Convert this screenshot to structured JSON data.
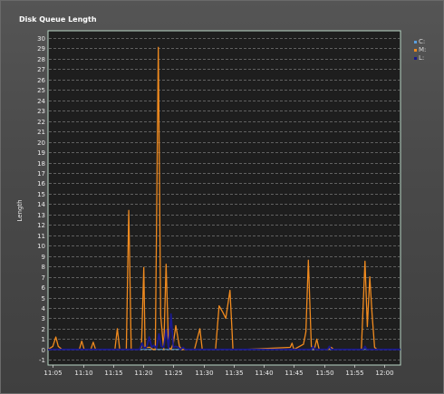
{
  "chart_data": {
    "type": "line",
    "title": "Disk Queue Length",
    "ylabel": "Length",
    "xlabel": "",
    "ylim": [
      -1.5,
      30.7
    ],
    "yticks": [
      -1,
      0,
      1,
      2,
      3,
      4,
      5,
      6,
      7,
      8,
      9,
      10,
      11,
      12,
      13,
      14,
      15,
      16,
      17,
      18,
      19,
      20,
      21,
      22,
      23,
      24,
      25,
      26,
      27,
      28,
      29,
      30
    ],
    "xlim": [
      64.2,
      122.7
    ],
    "xticks": [
      {
        "v": 65,
        "label": "11:05"
      },
      {
        "v": 70,
        "label": "11:10"
      },
      {
        "v": 75,
        "label": "11:15"
      },
      {
        "v": 80,
        "label": "11:20"
      },
      {
        "v": 85,
        "label": "11:25"
      },
      {
        "v": 90,
        "label": "11:30"
      },
      {
        "v": 95,
        "label": "11:35"
      },
      {
        "v": 100,
        "label": "11:40"
      },
      {
        "v": 105,
        "label": "11:45"
      },
      {
        "v": 110,
        "label": "11:50"
      },
      {
        "v": 115,
        "label": "11:55"
      },
      {
        "v": 120,
        "label": "12:00"
      }
    ],
    "grid": true,
    "legend_position": "right",
    "series": [
      {
        "name": "C:",
        "color": "#5aa0e0",
        "x": [
          64.2,
          122.7
        ],
        "y": [
          0,
          0
        ]
      },
      {
        "name": "M:",
        "color": "#f08a1e",
        "x": [
          64.2,
          65.0,
          65.5,
          65.9,
          66.5,
          69.4,
          69.8,
          70.2,
          71.3,
          71.7,
          72.1,
          75.3,
          75.7,
          76.1,
          77.2,
          77.6,
          78.0,
          79.3,
          79.7,
          80.1,
          80.3,
          81.2,
          81.6,
          82.0,
          82.5,
          82.9,
          83.4,
          83.8,
          84.2,
          84.6,
          85.0,
          85.4,
          86.0,
          86.4,
          86.8,
          88.5,
          89.0,
          89.4,
          89.8,
          92.0,
          92.6,
          93.2,
          93.7,
          94.4,
          94.9,
          95.4,
          95.9,
          96.4,
          96.9,
          104.4,
          104.7,
          105.0,
          106.6,
          107.0,
          107.4,
          107.9,
          108.4,
          108.8,
          109.2,
          109.6,
          110.0,
          110.8,
          111.2,
          111.6,
          116.2,
          116.8,
          117.2,
          117.6,
          118.0,
          118.4,
          118.8,
          119.2,
          119.6,
          122.7
        ],
        "y": [
          0,
          0.3,
          1.2,
          0.3,
          0,
          0,
          0.8,
          0,
          0,
          0.7,
          0,
          0,
          2.0,
          0,
          0,
          13.4,
          0,
          0,
          0.2,
          7.9,
          0.2,
          0.2,
          0,
          0,
          29.1,
          3.3,
          0,
          8.2,
          0.2,
          0,
          0.6,
          2.3,
          0.3,
          0,
          0,
          0,
          1.1,
          2.0,
          0,
          0,
          4.2,
          3.6,
          3.0,
          5.7,
          0,
          0,
          0,
          0,
          0,
          0.2,
          0.6,
          0,
          0.5,
          1.7,
          8.6,
          0.3,
          0,
          1.0,
          0,
          0,
          0,
          0,
          0.2,
          0,
          0,
          8.5,
          2.2,
          7.0,
          3.3,
          0.2,
          0,
          0,
          0,
          0
        ]
      },
      {
        "name": "L:",
        "color": "#1a1a8c",
        "x": [
          64.2,
          79.4,
          79.8,
          80.2,
          80.6,
          81.0,
          81.4,
          81.8,
          82.2,
          82.6,
          83.0,
          83.4,
          83.8,
          84.2,
          84.6,
          85.0,
          85.4,
          85.8,
          86.2,
          86.6,
          87.0,
          88.0,
          107.9,
          108.2,
          108.5,
          108.8,
          110.6,
          110.9,
          111.2,
          111.5,
          116.5,
          116.8,
          117.1,
          117.4,
          122.7
        ],
        "y": [
          0,
          0,
          0.6,
          0.1,
          0.3,
          1.2,
          0.2,
          0.4,
          0.1,
          1.5,
          0.3,
          0.2,
          1.9,
          0.1,
          3.4,
          0.2,
          0.3,
          0.2,
          0,
          0.2,
          0,
          0,
          0,
          0.3,
          0,
          0,
          0,
          0.3,
          0,
          0,
          0,
          0.3,
          0,
          0,
          0
        ]
      }
    ]
  }
}
